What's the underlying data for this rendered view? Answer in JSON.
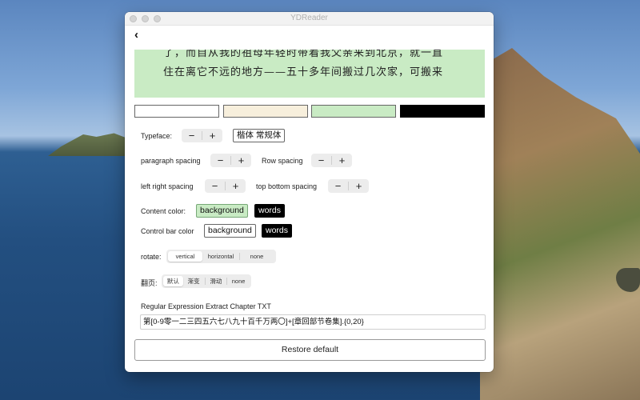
{
  "window": {
    "title": "YDReader"
  },
  "preview": {
    "line1": "了，而自从我的祖母年轻时带着我父亲来到北京，就一直",
    "line2": "住在离它不远的地方——五十多年间搬过几次家，可搬来"
  },
  "theme_swatches": [
    "#ffffff",
    "#f7efdc",
    "#c9ebc4",
    "#000000"
  ],
  "settings": {
    "typeface": {
      "label": "Typeface:",
      "minus": "−",
      "plus": "+",
      "current": "楷体 常规体"
    },
    "paragraph_spacing": {
      "label": "paragraph spacing",
      "minus": "−",
      "plus": "+"
    },
    "row_spacing": {
      "label": "Row spacing",
      "minus": "−",
      "plus": "+"
    },
    "left_right_spacing": {
      "label": "left right spacing",
      "minus": "−",
      "plus": "+"
    },
    "top_bottom_spacing": {
      "label": "top bottom spacing",
      "minus": "−",
      "plus": "+"
    },
    "content_color": {
      "label": "Content color:",
      "background": "background",
      "words": "words"
    },
    "control_bar_color": {
      "label": "Control bar color",
      "background": "background",
      "words": "words"
    },
    "rotate": {
      "label": "rotate:",
      "options": [
        "vertical",
        "horizontal",
        "none"
      ],
      "selected": "vertical"
    },
    "page_turn": {
      "label": "翻页:",
      "options": [
        "默认",
        "渐变",
        "滑动",
        "none"
      ],
      "selected": "默认"
    },
    "regex": {
      "label": "Regular Expression Extract Chapter TXT",
      "value": "第[0-9零一二三四五六七八九十百千万两〇]+[章回部节卷集].{0,20}"
    }
  },
  "restore_button": "Restore default",
  "colors": {
    "preview_bg": "#c9ebc4",
    "accent_green": "#c9ebc4",
    "black": "#000000"
  }
}
